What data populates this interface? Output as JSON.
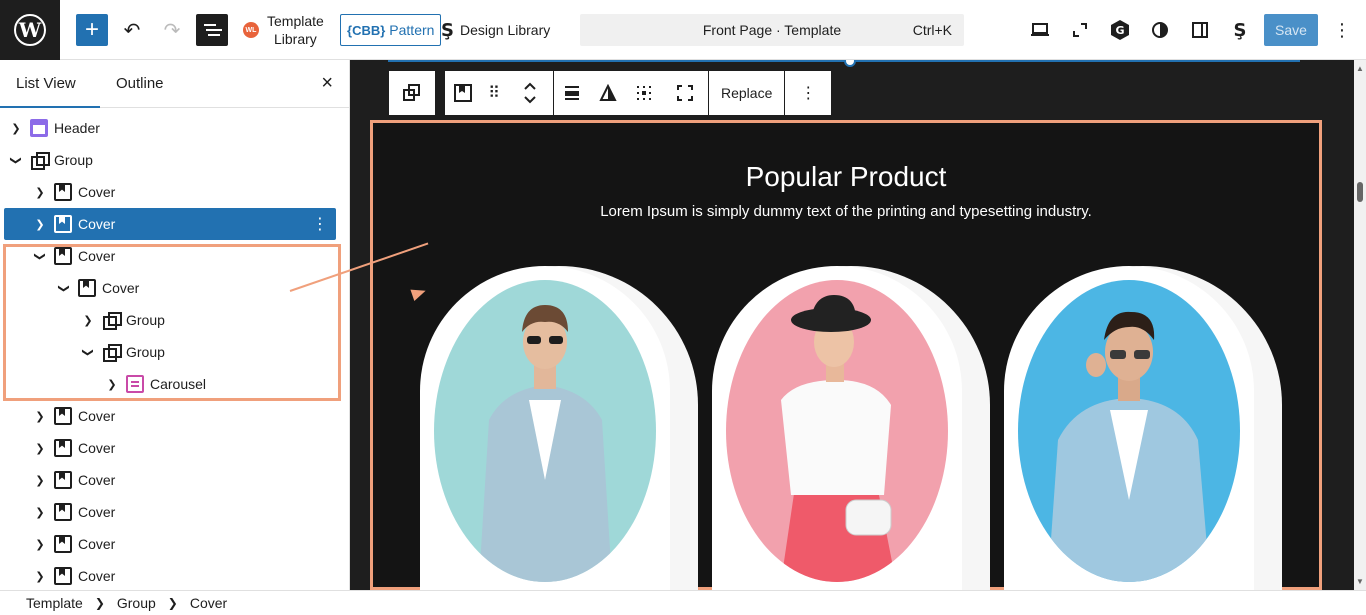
{
  "toolbar": {
    "add_label": "+",
    "template_library": [
      "Template",
      "Library"
    ],
    "pattern_label": "Pattern",
    "pattern_badge": "CBB",
    "design_library": "Design Library",
    "command": {
      "title": "Front Page · Template",
      "shortcut": "Ctrl+K"
    },
    "save_label": "Save"
  },
  "sidebar": {
    "tabs": [
      {
        "label": "List View"
      },
      {
        "label": "Outline"
      }
    ],
    "close": "×",
    "rows": [
      {
        "label": "Header",
        "icon": "header-icon"
      },
      {
        "label": "Group",
        "icon": "group-icon"
      },
      {
        "label": "Cover",
        "icon": "cover-icon"
      },
      {
        "label": "Cover",
        "icon": "cover-icon"
      },
      {
        "label": "Cover",
        "icon": "cover-icon"
      },
      {
        "label": "Cover",
        "icon": "cover-icon"
      },
      {
        "label": "Group",
        "icon": "group-icon"
      },
      {
        "label": "Group",
        "icon": "group-icon"
      },
      {
        "label": "Carousel",
        "icon": "carousel-icon"
      },
      {
        "label": "Cover",
        "icon": "cover-icon"
      },
      {
        "label": "Cover",
        "icon": "cover-icon"
      },
      {
        "label": "Cover",
        "icon": "cover-icon"
      },
      {
        "label": "Cover",
        "icon": "cover-icon"
      },
      {
        "label": "Cover",
        "icon": "cover-icon"
      },
      {
        "label": "Cover",
        "icon": "cover-icon"
      }
    ]
  },
  "block_toolbar": {
    "replace": "Replace"
  },
  "content": {
    "title": "Popular Product",
    "subtitle": "Lorem Ipsum is simply dummy text of the printing and typesetting industry."
  },
  "breadcrumb": [
    "Template",
    "Group",
    "Cover"
  ],
  "colors": {
    "accent": "#2271b1",
    "highlight": "#f0a07c",
    "canvas": "#1e1e1e"
  }
}
